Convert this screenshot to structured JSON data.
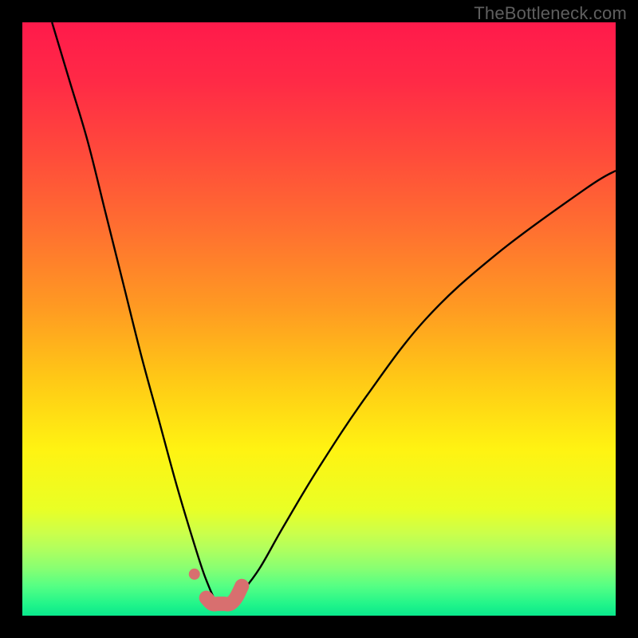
{
  "watermark": {
    "text": "TheBottleneck.com"
  },
  "colors": {
    "frame": "#000000",
    "watermark": "#5f5f5f",
    "curve": "#000000",
    "markers": "#d86f6f",
    "gradient_stops": [
      {
        "offset": 0.0,
        "color": "#ff1a4b"
      },
      {
        "offset": 0.1,
        "color": "#ff2a46"
      },
      {
        "offset": 0.22,
        "color": "#ff4a3b"
      },
      {
        "offset": 0.35,
        "color": "#ff7030"
      },
      {
        "offset": 0.48,
        "color": "#ff9a22"
      },
      {
        "offset": 0.6,
        "color": "#ffc816"
      },
      {
        "offset": 0.72,
        "color": "#fff312"
      },
      {
        "offset": 0.82,
        "color": "#e9ff25"
      },
      {
        "offset": 0.86,
        "color": "#ccff4a"
      },
      {
        "offset": 0.89,
        "color": "#aeff5f"
      },
      {
        "offset": 0.92,
        "color": "#88ff72"
      },
      {
        "offset": 0.95,
        "color": "#55ff84"
      },
      {
        "offset": 0.98,
        "color": "#22f58a"
      },
      {
        "offset": 1.0,
        "color": "#0ae88c"
      }
    ]
  },
  "chart_data": {
    "type": "line",
    "title": "",
    "xlabel": "",
    "ylabel": "",
    "xlim": [
      0,
      100
    ],
    "ylim": [
      0,
      100
    ],
    "grid": false,
    "curve_note": "a bottleneck curve: falls steeply from top-left to a minimum around x≈33, then rises gently toward the right; the minimum touches the bottom (green) band",
    "series": [
      {
        "name": "bottleneck-curve",
        "x": [
          5,
          8,
          11,
          14,
          17,
          20,
          23,
          26,
          29,
          31,
          33,
          35,
          37,
          40,
          44,
          50,
          58,
          68,
          80,
          95,
          100
        ],
        "y": [
          100,
          90,
          80,
          68,
          56,
          44,
          33,
          22,
          12,
          6,
          2,
          2,
          4,
          8,
          15,
          25,
          37,
          50,
          61,
          72,
          75
        ]
      },
      {
        "name": "marker-band",
        "points_note": "thick salmon highlight along the trough of the curve plus one detached dot just left of the trough",
        "x": [
          29,
          31,
          32,
          33,
          34,
          35,
          36,
          37
        ],
        "y": [
          7,
          3,
          2,
          2,
          2,
          2,
          3,
          5
        ]
      }
    ]
  }
}
